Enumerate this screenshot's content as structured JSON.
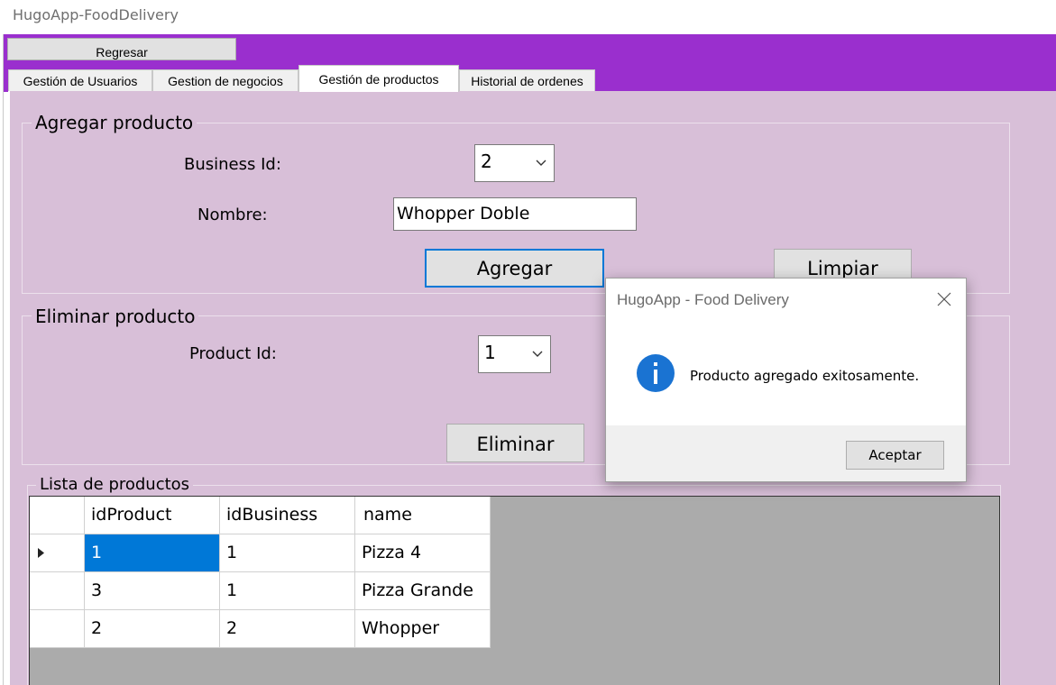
{
  "window": {
    "title": "HugoApp-FoodDelivery"
  },
  "toolbar": {
    "back_label": "Regresar"
  },
  "tabs": [
    {
      "label": "Gestión de Usuarios"
    },
    {
      "label": "Gestion de negocios"
    },
    {
      "label": "Gestión de productos"
    },
    {
      "label": "Historial de ordenes"
    }
  ],
  "add_product": {
    "legend": "Agregar producto",
    "business_id_label": "Business Id:",
    "business_id_value": "2",
    "name_label": "Nombre:",
    "name_value": "Whopper Doble",
    "add_button": "Agregar",
    "clear_button": "Limpiar"
  },
  "delete_product": {
    "legend": "Eliminar producto",
    "product_id_label": "Product Id:",
    "product_id_value": "1",
    "delete_button": "Eliminar"
  },
  "product_list": {
    "legend": "Lista de productos",
    "columns": [
      "idProduct",
      "idBusiness",
      "name"
    ],
    "rows": [
      [
        "1",
        "1",
        "Pizza 4"
      ],
      [
        "3",
        "1",
        "Pizza Grande"
      ],
      [
        "2",
        "2",
        "Whopper"
      ]
    ],
    "selected_cell": "row 1, idProduct"
  },
  "dialog": {
    "title": "HugoApp - Food Delivery",
    "message": "Producto agregado exitosamente.",
    "ok_button": "Aceptar",
    "icon": "info-icon"
  },
  "colors": {
    "purple_band": "#9a2fce",
    "panel_background": "#d8bfd8",
    "selection_blue": "#0078d7",
    "grid_background": "#ababab"
  }
}
